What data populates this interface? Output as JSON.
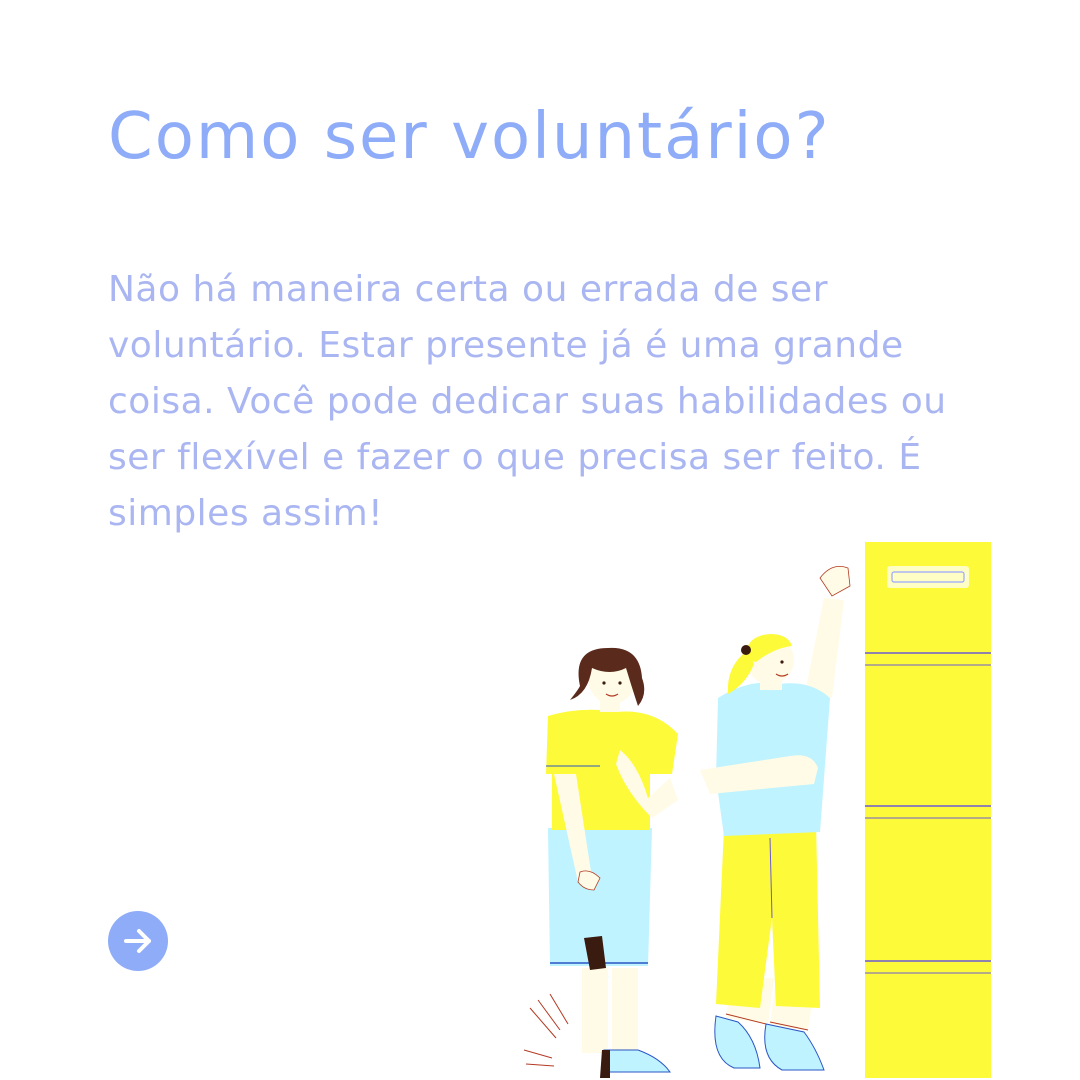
{
  "header": {
    "title": "Como ser voluntário?"
  },
  "main": {
    "paragraph": "Não há maneira certa ou errada de ser voluntário. Estar presente já é uma grande coisa. Você pode dedicar suas habilidades ou ser flexível e fazer o que precisa ser feito. É simples assim!"
  },
  "navigation": {
    "next_icon": "arrow-right-icon"
  },
  "colors": {
    "accent": "#8eacf7",
    "body_text": "#aab6f2",
    "yellow": "#fdfa3a",
    "light_blue": "#bff3ff",
    "skin": "#fffbe6",
    "hair_dark": "#5a2a1d"
  }
}
